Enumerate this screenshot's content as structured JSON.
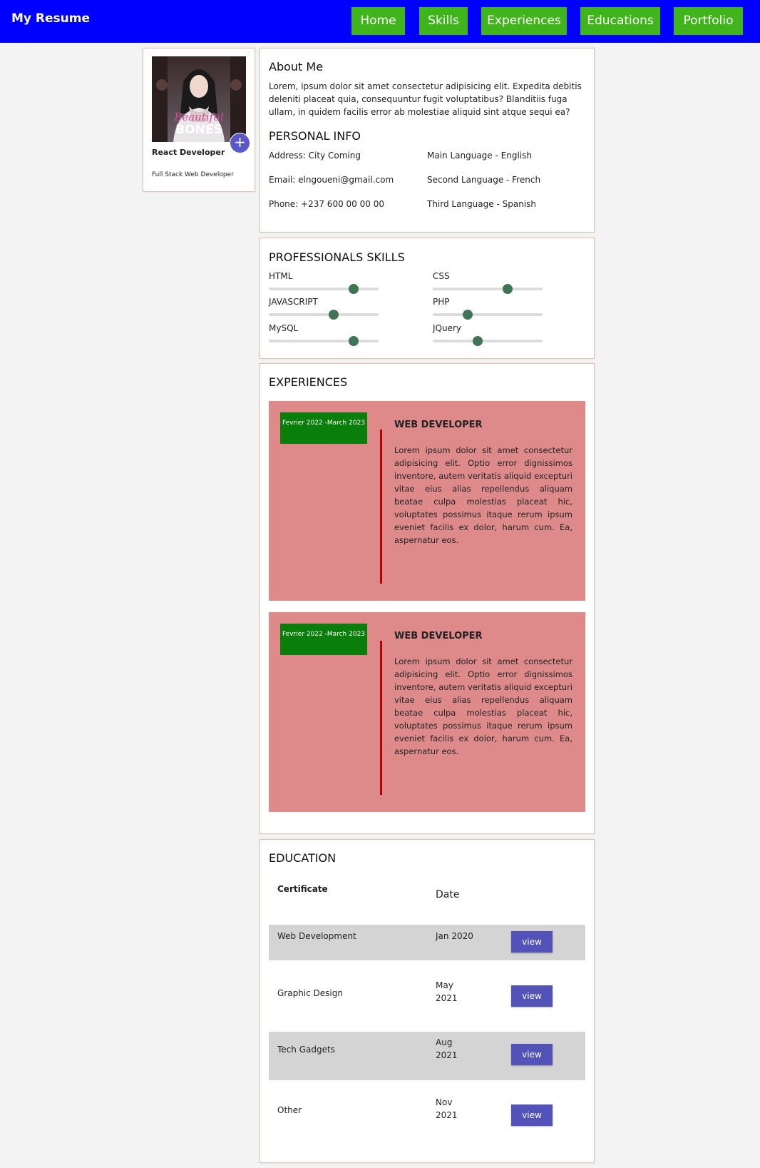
{
  "header": {
    "brand": "My Resume",
    "nav": [
      "Home",
      "Skills",
      "Experiences",
      "Educations",
      "Portfolio"
    ],
    "bg_color": "#0000ff",
    "nav_color": "#3fb51b"
  },
  "profile": {
    "photo_caption": "BONES",
    "title": "React Developer",
    "subtitle": "Full Stack Web Developer",
    "add_icon": "plus-icon"
  },
  "about": {
    "heading": "About Me",
    "text": "Lorem, ipsum dolor sit amet consectetur adipisicing elit. Expedita debitis deleniti placeat quia, consequuntur fugit voluptatibus? Blanditiis fuga ullam, in quidem facilis error ab molestiae aliquid sint atque sequi ea?"
  },
  "personal_info": {
    "heading": "PERSONAL INFO",
    "left": [
      "Address: City Coming",
      "Email: elngoueni@gmail.com",
      "Phone: +237 600 00 00 00"
    ],
    "right": [
      "Main Language - English",
      "Second Language - French",
      "Third Language - Spanish"
    ]
  },
  "skills": {
    "heading": "PROFESSIONALS SKILLS",
    "items": [
      {
        "name": "HTML",
        "level": 0.77
      },
      {
        "name": "CSS",
        "level": 0.68
      },
      {
        "name": "JAVASCRIPT",
        "level": 0.59
      },
      {
        "name": "PHP",
        "level": 0.32
      },
      {
        "name": "MySQL",
        "level": 0.77
      },
      {
        "name": "JQuery",
        "level": 0.41
      }
    ],
    "knob_color": "#3f7555"
  },
  "experiences": {
    "heading": "EXPERIENCES",
    "items": [
      {
        "date": "Fevrier 2022 -March 2023",
        "role": "WEB DEVELOPER",
        "desc": "Lorem ipsum dolor sit amet consectetur adipisicing elit. Optio error dignissimos inventore, autem veritatis aliquid excepturi vitae eius alias repellendus aliquam beatae culpa molestias placeat hic, voluptates possimus itaque rerum ipsum eveniet facilis ex dolor, harum cum. Ea, aspernatur eos."
      },
      {
        "date": "Fevrier 2022 -March 2023",
        "role": "WEB DEVELOPER",
        "desc": "Lorem ipsum dolor sit amet consectetur adipisicing elit. Optio error dignissimos inventore, autem veritatis aliquid excepturi vitae eius alias repellendus aliquam beatae culpa molestias placeat hic, voluptates possimus itaque rerum ipsum eveniet facilis ex dolor, harum cum. Ea, aspernatur eos."
      }
    ]
  },
  "education": {
    "heading": "EDUCATION",
    "col_certificate": "Certificate",
    "col_date": "Date",
    "rows": [
      {
        "certificate": "Web Development",
        "date": "Jan 2020",
        "action": "view"
      },
      {
        "certificate": "Graphic Design",
        "date": "May 2021",
        "action": "view"
      },
      {
        "certificate": "Tech Gadgets",
        "date": "Aug 2021",
        "action": "view"
      },
      {
        "certificate": "Other",
        "date": "Nov 2021",
        "action": "view"
      }
    ]
  }
}
